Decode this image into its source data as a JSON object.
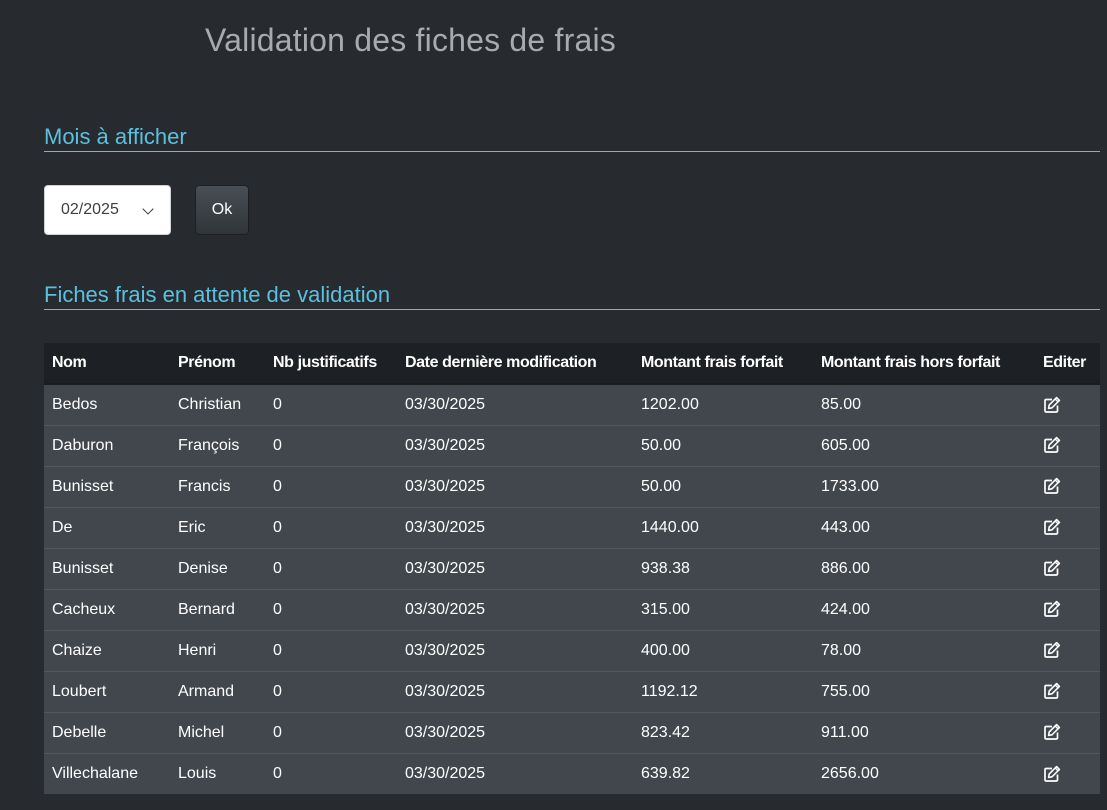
{
  "page": {
    "title": "Validation des fiches de frais"
  },
  "month_section": {
    "heading": "Mois à afficher",
    "selected_month": "02/2025",
    "ok_label": "Ok"
  },
  "pending_section": {
    "heading": "Fiches frais en attente de validation"
  },
  "table": {
    "headers": [
      "Nom",
      "Prénom",
      "Nb justificatifs",
      "Date dernière modification",
      "Montant frais forfait",
      "Montant frais hors forfait",
      "Editer"
    ],
    "rows": [
      {
        "nom": "Bedos",
        "prenom": "Christian",
        "nb": "0",
        "date": "03/30/2025",
        "forfait": "1202.00",
        "hors_forfait": "85.00"
      },
      {
        "nom": "Daburon",
        "prenom": "François",
        "nb": "0",
        "date": "03/30/2025",
        "forfait": "50.00",
        "hors_forfait": "605.00"
      },
      {
        "nom": "Bunisset",
        "prenom": "Francis",
        "nb": "0",
        "date": "03/30/2025",
        "forfait": "50.00",
        "hors_forfait": "1733.00"
      },
      {
        "nom": "De",
        "prenom": "Eric",
        "nb": "0",
        "date": "03/30/2025",
        "forfait": "1440.00",
        "hors_forfait": "443.00"
      },
      {
        "nom": "Bunisset",
        "prenom": "Denise",
        "nb": "0",
        "date": "03/30/2025",
        "forfait": "938.38",
        "hors_forfait": "886.00"
      },
      {
        "nom": "Cacheux",
        "prenom": "Bernard",
        "nb": "0",
        "date": "03/30/2025",
        "forfait": "315.00",
        "hors_forfait": "424.00"
      },
      {
        "nom": "Chaize",
        "prenom": "Henri",
        "nb": "0",
        "date": "03/30/2025",
        "forfait": "400.00",
        "hors_forfait": "78.00"
      },
      {
        "nom": "Loubert",
        "prenom": "Armand",
        "nb": "0",
        "date": "03/30/2025",
        "forfait": "1192.12",
        "hors_forfait": "755.00"
      },
      {
        "nom": "Debelle",
        "prenom": "Michel",
        "nb": "0",
        "date": "03/30/2025",
        "forfait": "823.42",
        "hors_forfait": "911.00"
      },
      {
        "nom": "Villechalane",
        "prenom": "Louis",
        "nb": "0",
        "date": "03/30/2025",
        "forfait": "639.82",
        "hors_forfait": "2656.00"
      }
    ],
    "edit_icon": "edit-icon"
  },
  "colors": {
    "background": "#272b30",
    "accent": "#5bc0de",
    "header_row": "#1d2024",
    "body_row": "#41474d"
  }
}
